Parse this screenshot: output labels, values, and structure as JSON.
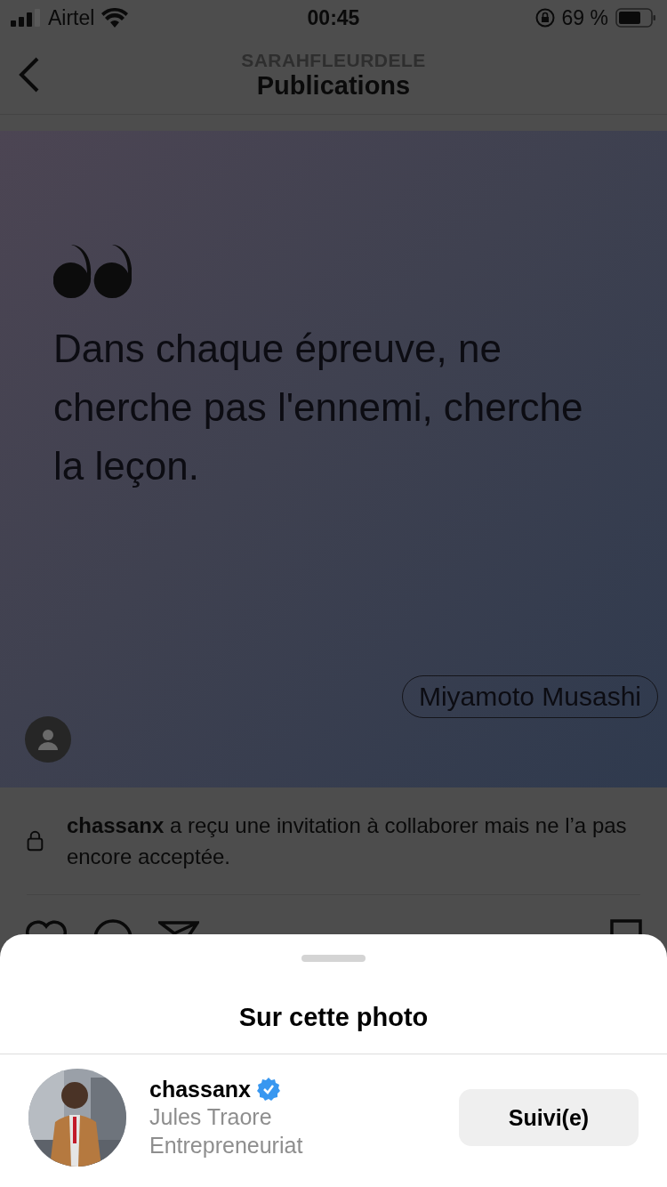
{
  "status_bar": {
    "carrier": "Airtel",
    "time": "00:45",
    "battery": "69 %"
  },
  "header": {
    "username": "SARAHFLEURDELE",
    "title": "Publications"
  },
  "post": {
    "quote": "Dans chaque épreuve, ne cherche pas l'ennemi, cherche la leçon.",
    "author": "Miyamoto Musashi"
  },
  "collab_notice": "**chassanx** a reçu une invitation à collaborer mais ne l’a pas encore acceptée.",
  "sheet": {
    "title": "Sur cette photo",
    "people": [
      {
        "username": "chassanx",
        "verified": true,
        "name": "Jules Traore",
        "category": "Entrepreneuriat",
        "button": "Suivi(e)"
      }
    ]
  }
}
